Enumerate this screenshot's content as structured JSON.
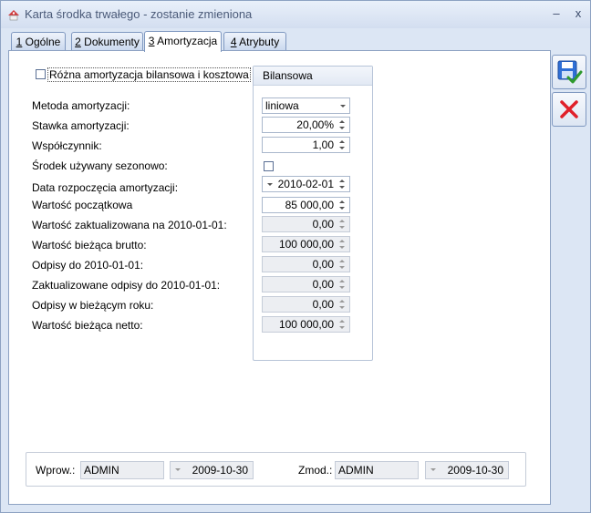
{
  "window": {
    "title": "Karta środka trwałego - zostanie zmieniona",
    "minimize": "–",
    "close": "x"
  },
  "tabs": [
    {
      "num": "1",
      "label": " Ogólne"
    },
    {
      "num": "2",
      "label": " Dokumenty"
    },
    {
      "num": "3",
      "label": " Amortyzacja"
    },
    {
      "num": "4",
      "label": " Atrybuty"
    }
  ],
  "form": {
    "different_label": "Różna amortyzacja bilansowa i kosztowa",
    "group_title": "Bilansowa",
    "method_label": "Metoda amortyzacji:",
    "method_value": "liniowa",
    "rate_label": "Stawka amortyzacji:",
    "rate_value": "20,00%",
    "coef_label": "Współczynnik:",
    "coef_value": "1,00",
    "seasonal_label": "Środek używany sezonowo:",
    "start_label": "Data rozpoczęcia amortyzacji:",
    "start_value": "2010-02-01",
    "initial_label": "Wartość początkowa",
    "initial_value": "85 000,00",
    "updated_label": "Wartość zaktualizowana na 2010-01-01:",
    "updated_value": "0,00",
    "gross_label": "Wartość bieżąca brutto:",
    "gross_value": "100 000,00",
    "writeoffs_label": "Odpisy do 2010-01-01:",
    "writeoffs_value": "0,00",
    "upd_writeoffs_label": "Zaktualizowane odpisy do 2010-01-01:",
    "upd_writeoffs_value": "0,00",
    "year_writeoffs_label": "Odpisy w bieżącym roku:",
    "year_writeoffs_value": "0,00",
    "net_label": "Wartość bieżąca netto:",
    "net_value": "100 000,00"
  },
  "footer": {
    "entered_label": "Wprow.:",
    "entered_user": "ADMIN",
    "entered_date": "2009-10-30",
    "modified_label": "Zmod.:",
    "modified_user": "ADMIN",
    "modified_date": "2009-10-30"
  },
  "colors": {
    "save_accent": "#2f6fd6",
    "cancel_red": "#e0202a",
    "check_green": "#2e9a2e"
  }
}
